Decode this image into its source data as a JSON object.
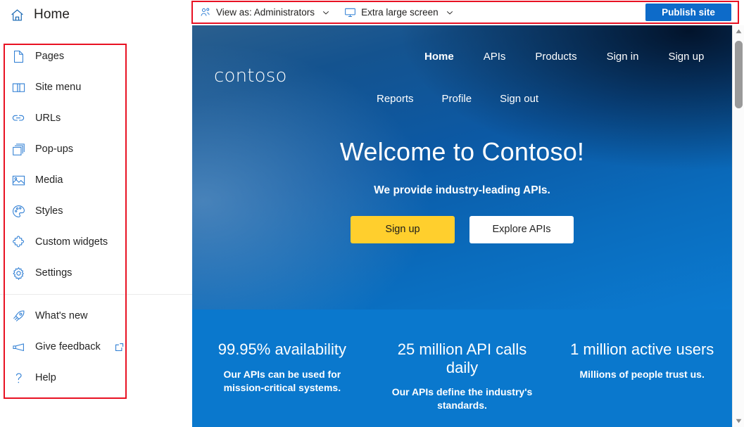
{
  "header": {
    "title": "Home",
    "icon": "home-icon"
  },
  "sidebar": {
    "primary_items": [
      {
        "label": "Pages",
        "icon": "page-icon"
      },
      {
        "label": "Site menu",
        "icon": "book-icon"
      },
      {
        "label": "URLs",
        "icon": "link-icon"
      },
      {
        "label": "Pop-ups",
        "icon": "windows-stack-icon"
      },
      {
        "label": "Media",
        "icon": "image-icon"
      },
      {
        "label": "Styles",
        "icon": "palette-icon"
      },
      {
        "label": "Custom widgets",
        "icon": "widget-icon"
      },
      {
        "label": "Settings",
        "icon": "gear-icon"
      }
    ],
    "secondary_items": [
      {
        "label": "What's new",
        "icon": "rocket-icon",
        "external": false
      },
      {
        "label": "Give feedback",
        "icon": "megaphone-icon",
        "external": true
      },
      {
        "label": "Help",
        "icon": "question-mark-icon",
        "external": false
      }
    ]
  },
  "toolbar": {
    "view_as": {
      "label": "View as: Administrators",
      "icon": "people-icon",
      "chevron": "chevron-down-icon"
    },
    "screen_size": {
      "label": "Extra large screen",
      "icon": "monitor-icon",
      "chevron": "chevron-down-icon"
    },
    "publish_label": "Publish site",
    "publish_color": "#0d6bc9"
  },
  "preview": {
    "site": {
      "logo": "contoso",
      "nav_row1": [
        {
          "label": "Home",
          "active": true
        },
        {
          "label": "APIs",
          "active": false
        },
        {
          "label": "Products",
          "active": false
        },
        {
          "label": "Sign in",
          "active": false
        },
        {
          "label": "Sign up",
          "active": false
        }
      ],
      "nav_row2": [
        {
          "label": "Reports",
          "active": false
        },
        {
          "label": "Profile",
          "active": false
        },
        {
          "label": "Sign out",
          "active": false
        }
      ],
      "hero": {
        "title": "Welcome to Contoso!",
        "subtitle": "We provide industry-leading APIs.",
        "primary_cta": "Sign up",
        "secondary_cta": "Explore APIs",
        "primary_cta_color": "#ffcf2d",
        "secondary_cta_color": "#ffffff"
      },
      "stats": [
        {
          "value": "99.95% availability",
          "description": "Our APIs can be used for mission-critical systems."
        },
        {
          "value": "25 million API calls daily",
          "description": "Our APIs define the industry's standards."
        },
        {
          "value": "1 million active users",
          "description": "Millions of people trust us."
        }
      ],
      "band_color": "#0a78cd"
    }
  },
  "scrollbar": {
    "up_icon": "triangle-up-icon",
    "down_icon": "triangle-down-icon"
  },
  "annotations": {
    "accent_color": "#e81123"
  }
}
